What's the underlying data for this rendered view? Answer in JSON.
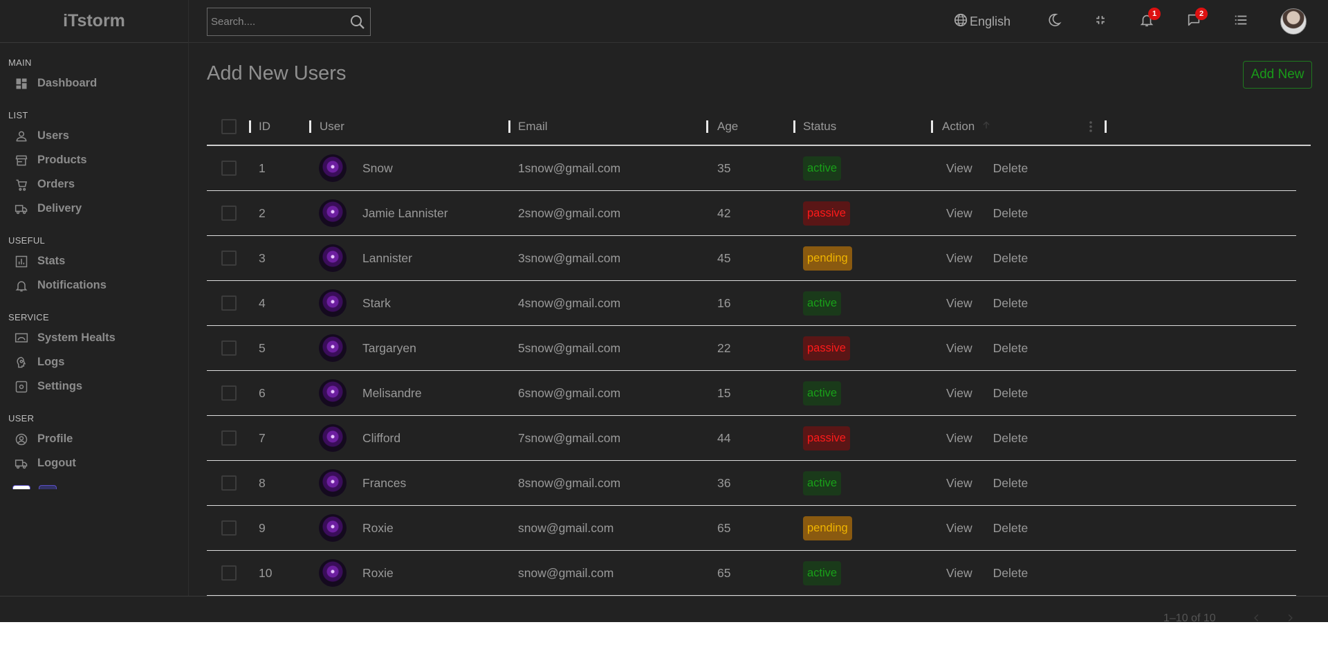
{
  "app": {
    "brand": "iTstorm"
  },
  "sidebar": {
    "sections": [
      {
        "title": "MAIN",
        "items": [
          {
            "label": "Dashboard",
            "icon": "dashboard-icon"
          }
        ]
      },
      {
        "title": "LIST",
        "items": [
          {
            "label": "Users",
            "icon": "person-icon"
          },
          {
            "label": "Products",
            "icon": "store-icon"
          },
          {
            "label": "Orders",
            "icon": "cart-icon"
          },
          {
            "label": "Delivery",
            "icon": "truck-icon"
          }
        ]
      },
      {
        "title": "USEFUL",
        "items": [
          {
            "label": "Stats",
            "icon": "chart-icon"
          },
          {
            "label": "Notifications",
            "icon": "bell-icon"
          }
        ]
      },
      {
        "title": "SERVICE",
        "items": [
          {
            "label": "System Healts",
            "icon": "settings-system-icon"
          },
          {
            "label": "Logs",
            "icon": "psychology-icon"
          },
          {
            "label": "Settings",
            "icon": "settings-icon"
          }
        ]
      },
      {
        "title": "USER",
        "items": [
          {
            "label": "Profile",
            "icon": "account-circle-icon"
          },
          {
            "label": "Logout",
            "icon": "truck-icon"
          }
        ]
      }
    ]
  },
  "navbar": {
    "search_placeholder": "Search....",
    "language": "English",
    "notifications_count": "1",
    "messages_count": "2"
  },
  "page": {
    "title": "Add New Users",
    "add_button": "Add New"
  },
  "table": {
    "headers": {
      "id": "ID",
      "user": "User",
      "email": "Email",
      "age": "Age",
      "status": "Status",
      "action": "Action"
    },
    "actions": {
      "view": "View",
      "delete": "Delete"
    },
    "rows": [
      {
        "id": "1",
        "user": "Snow",
        "email": "1snow@gmail.com",
        "age": "35",
        "status": "active"
      },
      {
        "id": "2",
        "user": "Jamie Lannister",
        "email": "2snow@gmail.com",
        "age": "42",
        "status": "passive"
      },
      {
        "id": "3",
        "user": "Lannister",
        "email": "3snow@gmail.com",
        "age": "45",
        "status": "pending"
      },
      {
        "id": "4",
        "user": "Stark",
        "email": "4snow@gmail.com",
        "age": "16",
        "status": "active"
      },
      {
        "id": "5",
        "user": "Targaryen",
        "email": "5snow@gmail.com",
        "age": "22",
        "status": "passive"
      },
      {
        "id": "6",
        "user": "Melisandre",
        "email": "6snow@gmail.com",
        "age": "15",
        "status": "active"
      },
      {
        "id": "7",
        "user": "Clifford",
        "email": "7snow@gmail.com",
        "age": "44",
        "status": "passive"
      },
      {
        "id": "8",
        "user": "Frances",
        "email": "8snow@gmail.com",
        "age": "36",
        "status": "active"
      },
      {
        "id": "9",
        "user": "Roxie",
        "email": "snow@gmail.com",
        "age": "65",
        "status": "pending"
      },
      {
        "id": "10",
        "user": "Roxie",
        "email": "snow@gmail.com",
        "age": "65",
        "status": "active"
      }
    ],
    "pagination": "1–10 of 10"
  },
  "colors": {
    "background": "#222222",
    "active": "#19a019",
    "passive": "#ff1a1a",
    "pending": "#f0b400",
    "accent": "#199b19"
  }
}
